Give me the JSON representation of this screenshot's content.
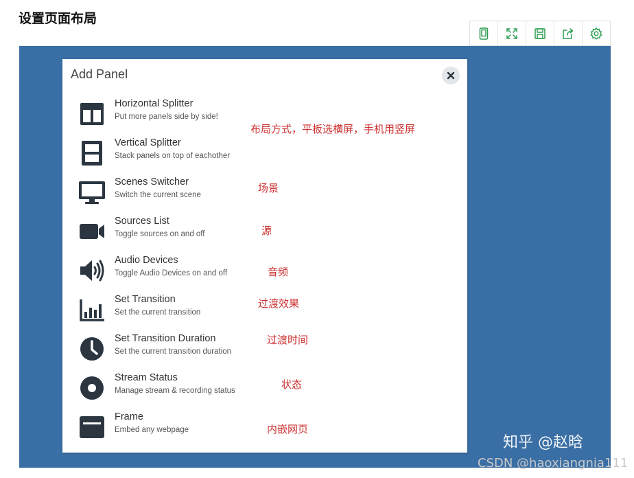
{
  "page": {
    "title": "设置页面布局"
  },
  "toolbar": {
    "buttons": [
      {
        "icon": "tablet-icon"
      },
      {
        "icon": "fullscreen-icon"
      },
      {
        "icon": "save-icon"
      },
      {
        "icon": "share-icon"
      },
      {
        "icon": "gear-icon"
      }
    ],
    "accent": "#2e9e52"
  },
  "colors": {
    "stage": "#3a6fa5",
    "icon": "#2b3641",
    "note": "#cc2f2f"
  },
  "dialog": {
    "title": "Add Panel",
    "items": [
      {
        "name": "Horizontal Splitter",
        "desc": "Put more panels side by side!",
        "icon": "horizontal-splitter-icon"
      },
      {
        "name": "Vertical Splitter",
        "desc": "Stack panels on top of eachother",
        "icon": "vertical-splitter-icon"
      },
      {
        "name": "Scenes Switcher",
        "desc": "Switch the current scene",
        "icon": "monitor-icon"
      },
      {
        "name": "Sources List",
        "desc": "Toggle sources on and off",
        "icon": "video-camera-icon"
      },
      {
        "name": "Audio Devices",
        "desc": "Toggle Audio Devices on and off",
        "icon": "speaker-icon"
      },
      {
        "name": "Set Transition",
        "desc": "Set the current transition",
        "icon": "bar-chart-icon"
      },
      {
        "name": "Set Transition Duration",
        "desc": "Set the current transition duration",
        "icon": "clock-icon"
      },
      {
        "name": "Stream Status",
        "desc": "Manage stream & recording status",
        "icon": "record-icon"
      },
      {
        "name": "Frame",
        "desc": "Embed any webpage",
        "icon": "frame-icon"
      }
    ]
  },
  "annotations": {
    "layout": "布局方式，平板选横屏，手机用竖屏",
    "scene": "场景",
    "source": "源",
    "audio": "音频",
    "transition": "过渡效果",
    "transition_time": "过渡时间",
    "status": "状态",
    "frame": "内嵌网页"
  },
  "watermarks": {
    "zhihu": "知乎 @赵晗",
    "csdn": "CSDN @haoxiangnia111"
  }
}
